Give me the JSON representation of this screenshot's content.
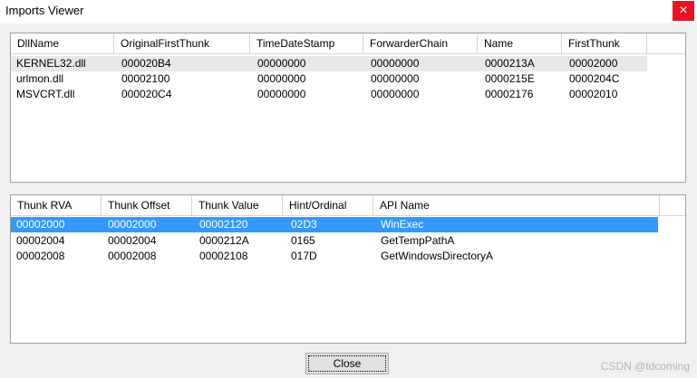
{
  "window": {
    "title": "Imports Viewer",
    "close_glyph": "×"
  },
  "dll_table": {
    "columns": [
      "DllName",
      "OriginalFirstThunk",
      "TimeDateStamp",
      "ForwarderChain",
      "Name",
      "FirstThunk"
    ],
    "rows": [
      [
        "KERNEL32.dll",
        "000020B4",
        "00000000",
        "00000000",
        "0000213A",
        "00002000"
      ],
      [
        "urlmon.dll",
        "00002100",
        "00000000",
        "00000000",
        "0000215E",
        "0000204C"
      ],
      [
        "MSVCRT.dll",
        "000020C4",
        "00000000",
        "00000000",
        "00002176",
        "00002010"
      ]
    ]
  },
  "thunk_table": {
    "columns": [
      "Thunk RVA",
      "Thunk Offset",
      "Thunk Value",
      "Hint/Ordinal",
      "API Name"
    ],
    "rows": [
      [
        "00002000",
        "00002000",
        "00002120",
        "02D3",
        "WinExec"
      ],
      [
        "00002004",
        "00002004",
        "0000212A",
        "0165",
        "GetTempPathA"
      ],
      [
        "00002008",
        "00002008",
        "00002108",
        "017D",
        "GetWindowsDirectoryA"
      ]
    ]
  },
  "buttons": {
    "close_label": "Close"
  },
  "watermark": "CSDN @tdcoming",
  "colors": {
    "selection": "#3399ff",
    "close_hover": "#e81123"
  }
}
